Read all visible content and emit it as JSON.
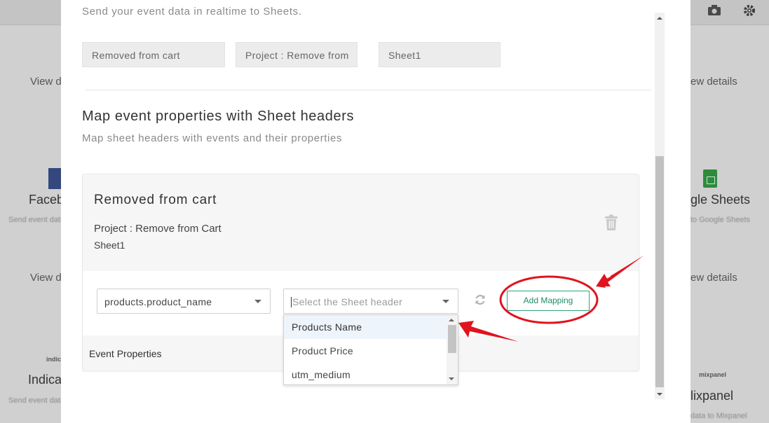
{
  "background": {
    "left_view_details_1": "View d",
    "left_view_details_2": "View d",
    "right_view_details_1": "ew details",
    "right_view_details_2": "ew details",
    "left_card_title_1": "Faceb",
    "left_card_title_2": "Indica",
    "right_card_title_1": "gle Sheets",
    "right_card_title_2": "lixpanel",
    "left_logo_text": "indica",
    "right_logo_text": "mixpanel",
    "left_sub_1": "Send event data to...",
    "left_sub_2": "Send event data to...",
    "right_sub_1": "to Google Sheets",
    "right_sub_2": "data to Mixpanel"
  },
  "modal": {
    "subtitle": "Send your event data in realtime to Sheets.",
    "fields": {
      "event": "Removed from cart",
      "project": "Project : Remove from",
      "sheet": "Sheet1"
    },
    "section_title": "Map event properties with Sheet headers",
    "section_desc": "Map sheet headers with events and their properties",
    "card": {
      "title": "Removed from cart",
      "project": "Project : Remove from Cart",
      "sheet": "Sheet1",
      "event_select_value": "products.product_name",
      "header_select_placeholder": "Select the Sheet header",
      "add_mapping_label": "Add Mapping",
      "event_properties_label": "Event Properties",
      "dropdown_options": [
        "Products Name",
        "Product Price",
        "utm_medium"
      ]
    }
  },
  "colors": {
    "accent_green": "#1f8e66",
    "annotation_red": "#e0141e"
  }
}
